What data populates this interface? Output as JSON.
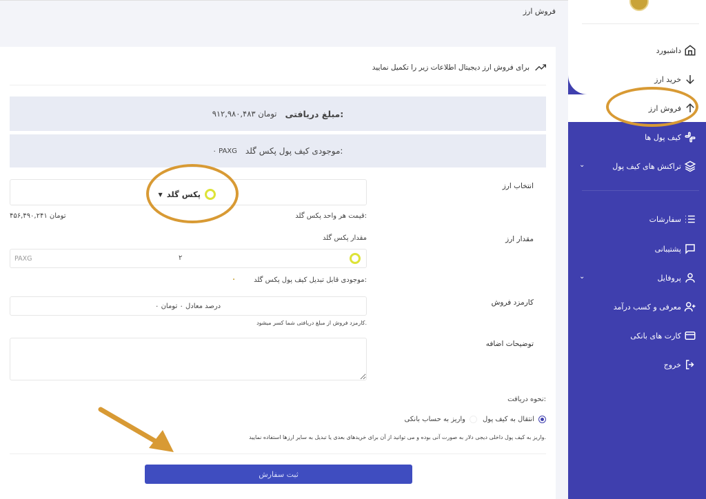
{
  "header": {
    "title": "فروش ارز"
  },
  "sidebar": {
    "items": [
      {
        "label": "داشبورد",
        "icon": "home-icon"
      },
      {
        "label": "خرید ارز",
        "icon": "arrow-down-icon"
      },
      {
        "label": "فروش ارز",
        "icon": "arrow-up-icon"
      },
      {
        "label": "کیف پول ها",
        "icon": "slack-icon"
      },
      {
        "label": "تراکنش های کیف پول",
        "icon": "layers-icon"
      },
      {
        "label": "سفارشات",
        "icon": "list-icon"
      },
      {
        "label": "پشتیبانی",
        "icon": "chat-icon"
      },
      {
        "label": "پروفایل",
        "icon": "user-icon"
      },
      {
        "label": "معرفی و کسب درآمد",
        "icon": "user-plus-icon"
      },
      {
        "label": "کارت های بانکی",
        "icon": "credit-card-icon"
      },
      {
        "label": "خروج",
        "icon": "logout-icon"
      }
    ]
  },
  "form": {
    "intro": "برای فروش ارز دیجیتال اطلاعات زیر را تکمیل نمایید",
    "received_label": "مبلغ دریافتی:",
    "received_value": "۹۱۲,۹۸۰,۴۸۳ تومان",
    "balance_label": "موجودی کیف پول پکس گلد:",
    "balance_value": "۰ PAXG",
    "currency_label": "انتخاب ارز",
    "currency_value": "پکس گلد",
    "unit_price_label": "قیمت هر واحد پکس گلد:",
    "unit_price_value": "۴۵۶,۴۹۰,۲۴۱ تومان",
    "amount_label": "مقدار ارز",
    "amount_sublabel": "مقدار پکس گلد",
    "amount_value": "۲",
    "amount_unit": "PAXG",
    "convertible_label": "موجودی قابل تبدیل کیف پول پکس گلد:",
    "convertible_value": "۰",
    "fee_label": "کارمزد فروش",
    "fee_value": "۰ درصد معادل ۰ تومان",
    "fee_note": "کارمزد فروش از مبلغ دریافتی شما کسر میشود.",
    "notes_label": "توضیحات اضافه",
    "method_label": "نحوه دریافت:",
    "method_wallet": "انتقال به کیف پول",
    "method_bank": "واریز به حساب بانکی",
    "method_note": "واریز به کیف پول داخلی دیجی دلار به صورت آنی بوده و می توانید از آن برای خریدهای بعدی یا تبدیل به سایر ارزها استفاده نمایید.",
    "submit_label": "ثبت سفارش"
  },
  "colors": {
    "primary": "#3f3fae",
    "button": "#3f4dc0",
    "highlight": "#d89a34",
    "coin": "#dde337"
  }
}
